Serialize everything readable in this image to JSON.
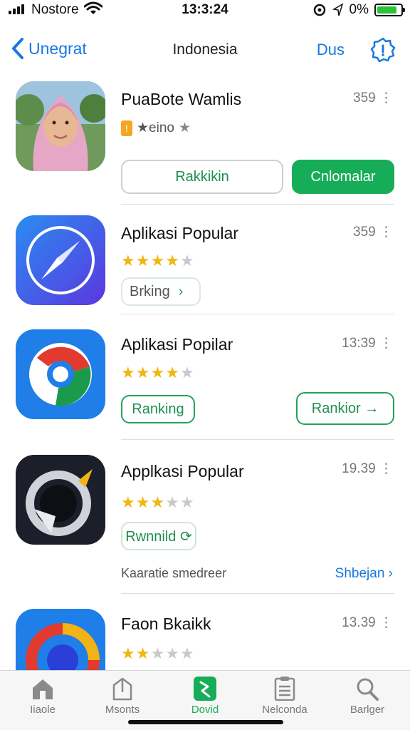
{
  "status_bar": {
    "carrier": "Nostore",
    "time": "13:3:24",
    "battery_text": "0%",
    "battery_level": 0.85,
    "battery_color": "#2dc23a"
  },
  "nav": {
    "back_label": "Unegrat",
    "title": "Indonesia",
    "action_label": "Dus",
    "accent_color": "#1778e0"
  },
  "apps": [
    {
      "name": "PuaBote Wamlis",
      "meta": "359",
      "rating_text": "★eino",
      "primary_button": "Rakkikin",
      "secondary_button": "Cnlomalar",
      "icon": "portrait-photo"
    },
    {
      "name": "Aplikasi Popular",
      "meta": "359",
      "stars": 4,
      "tag_button": "Brking",
      "icon": "compass-icon"
    },
    {
      "name": "Aplikasi Popilar",
      "meta": "13:39",
      "stars": 4,
      "ranking_button": "Ranking",
      "action_button": "Rankior →",
      "icon": "ring-icon"
    },
    {
      "name": "Applkasi Popular",
      "meta": "19.39",
      "stars": 3,
      "tag_button": "Rwnnild ⟳",
      "footer_text": "Kaaratie smedreer",
      "footer_link": "Shbejan",
      "icon": "dark-ring-icon"
    },
    {
      "name": "Faon Bkaikk",
      "meta": "13.39",
      "stars": 2,
      "icon": "colorful-ring-icon"
    }
  ],
  "tab_bar": {
    "items": [
      {
        "label": "Iiaole",
        "icon": "home-icon"
      },
      {
        "label": "Msonts",
        "icon": "book-icon"
      },
      {
        "label": "Dovid",
        "icon": "apps-icon",
        "active": true
      },
      {
        "label": "Nelconda",
        "icon": "list-icon"
      },
      {
        "label": "Barlger",
        "icon": "search-icon"
      }
    ],
    "active_color": "#17ad58"
  }
}
